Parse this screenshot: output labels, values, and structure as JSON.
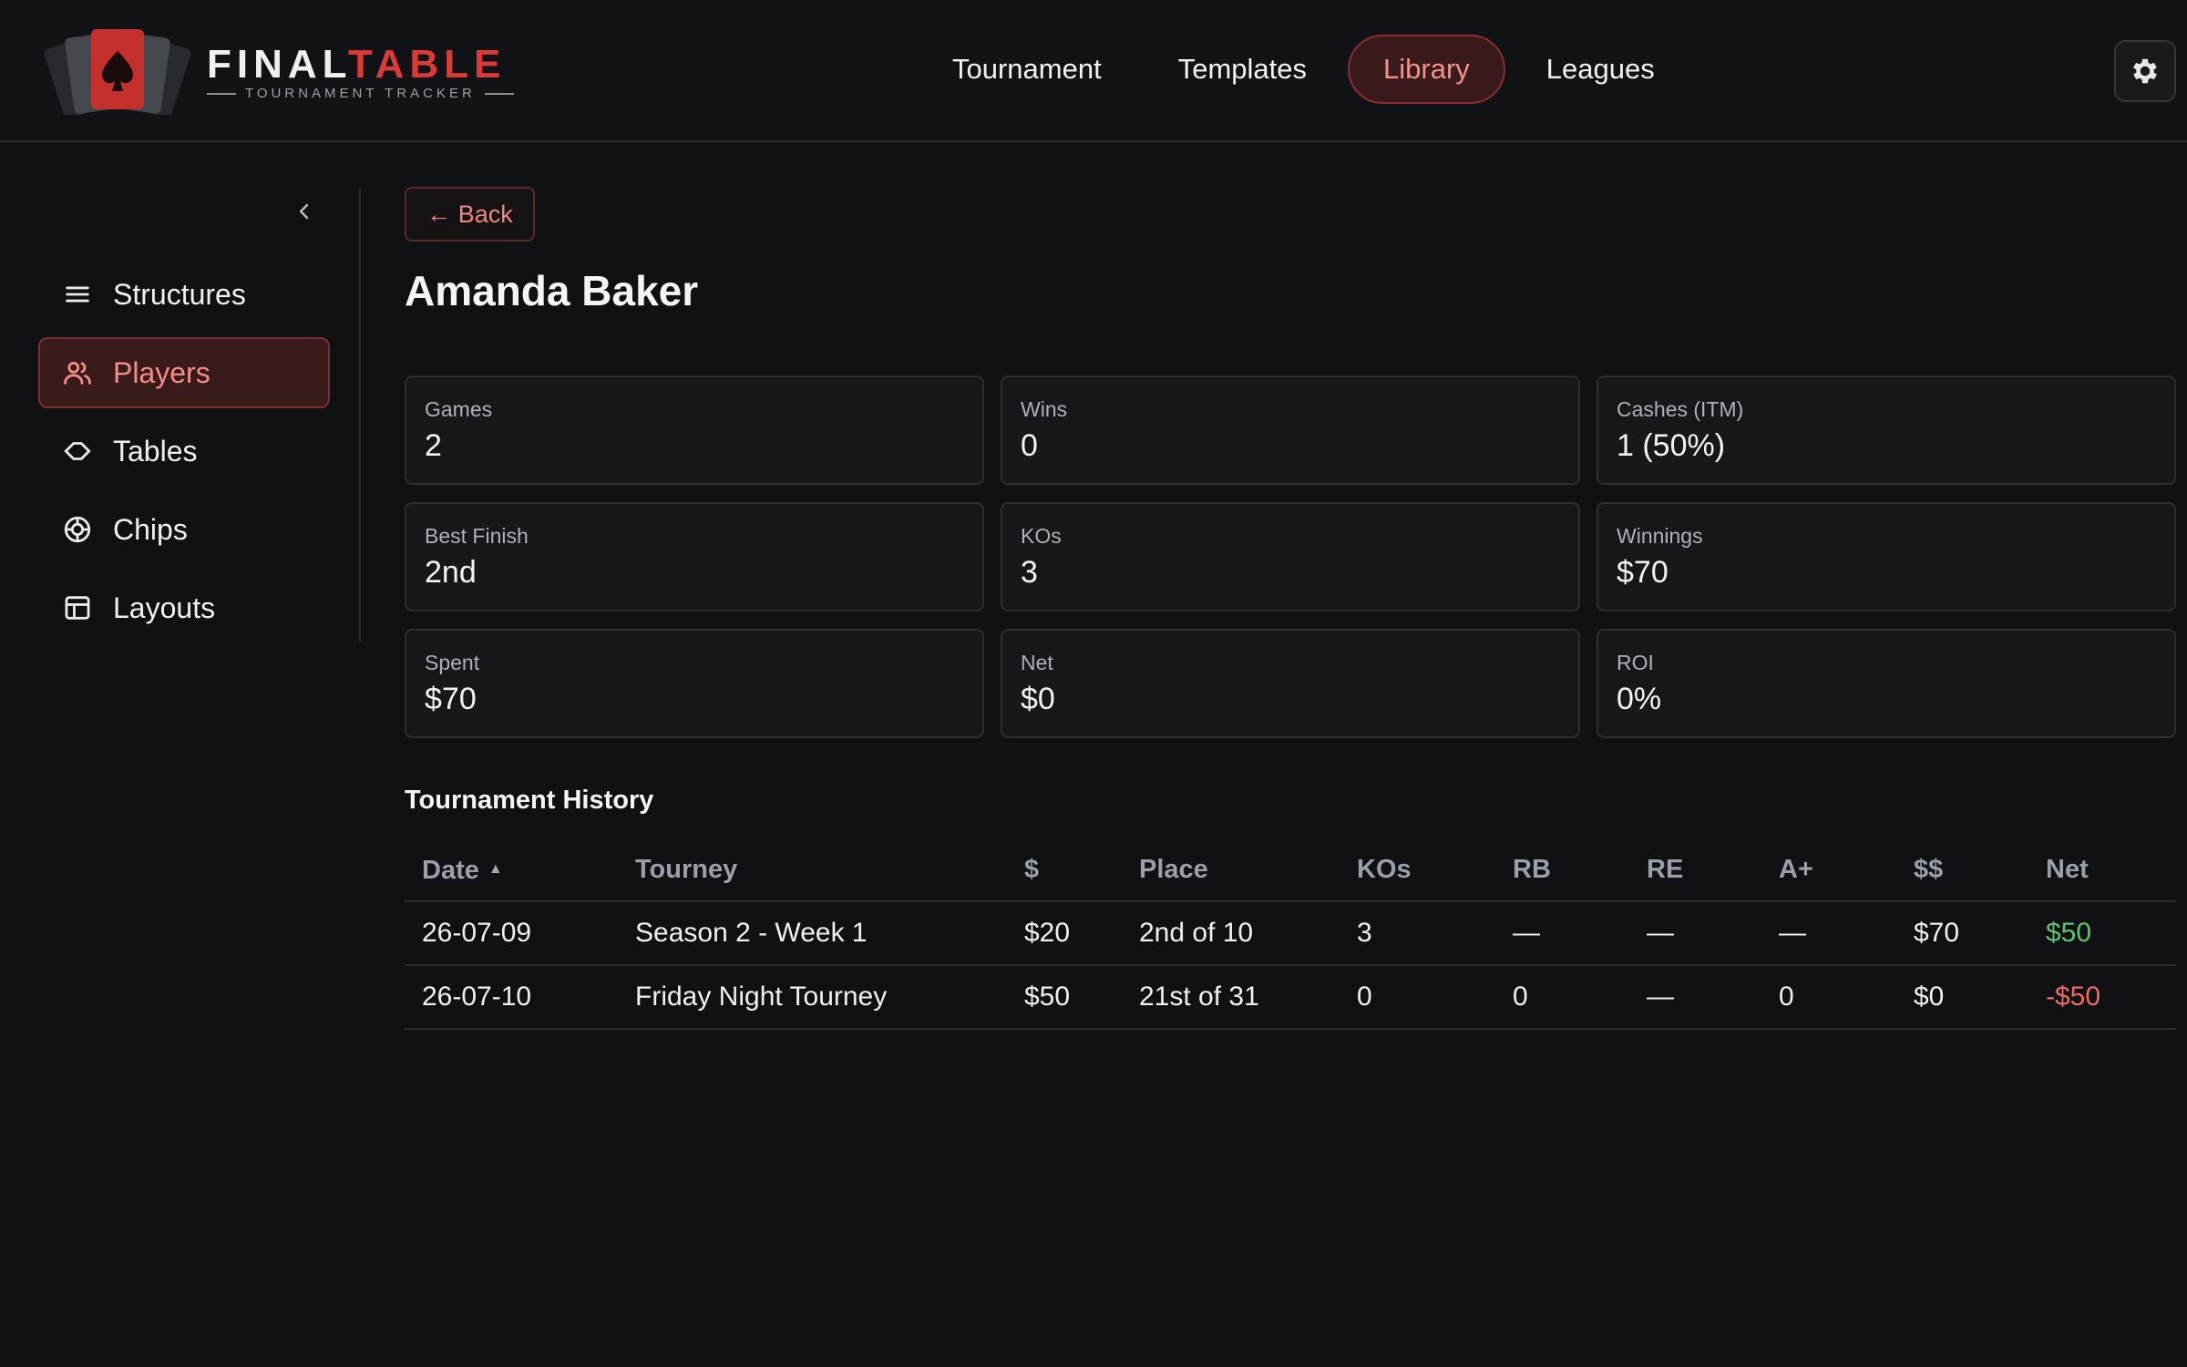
{
  "brand": {
    "title_a": "FINAL",
    "title_b": "TABLE",
    "subtitle": "TOURNAMENT TRACKER"
  },
  "nav": {
    "tabs": [
      {
        "label": "Tournament",
        "active": false
      },
      {
        "label": "Templates",
        "active": false
      },
      {
        "label": "Library",
        "active": true
      },
      {
        "label": "Leagues",
        "active": false
      }
    ]
  },
  "settings_icon": "gear-icon",
  "sidebar": {
    "collapse_icon": "chevron-left-icon",
    "items": [
      {
        "label": "Structures",
        "icon": "menu-lines-icon",
        "active": false
      },
      {
        "label": "Players",
        "icon": "users-icon",
        "active": true
      },
      {
        "label": "Tables",
        "icon": "table-oval-icon",
        "active": false
      },
      {
        "label": "Chips",
        "icon": "chip-icon",
        "active": false
      },
      {
        "label": "Layouts",
        "icon": "layout-icon",
        "active": false
      }
    ]
  },
  "back_label": "← Back",
  "player": {
    "name": "Amanda Baker"
  },
  "stats": [
    {
      "label": "Games",
      "value": "2"
    },
    {
      "label": "Wins",
      "value": "0"
    },
    {
      "label": "Cashes (ITM)",
      "value": "1 (50%)"
    },
    {
      "label": "Best Finish",
      "value": "2nd"
    },
    {
      "label": "KOs",
      "value": "3"
    },
    {
      "label": "Winnings",
      "value": "$70"
    },
    {
      "label": "Spent",
      "value": "$70"
    },
    {
      "label": "Net",
      "value": "$0"
    },
    {
      "label": "ROI",
      "value": "0%"
    }
  ],
  "history": {
    "title": "Tournament History",
    "sort_indicator": "▲",
    "columns": [
      "Date",
      "Tourney",
      "$",
      "Place",
      "KOs",
      "RB",
      "RE",
      "A+",
      "$$",
      "Net"
    ],
    "rows": [
      [
        "26-07-09",
        "Season 2 - Week 1",
        "$20",
        "2nd of 10",
        "3",
        "—",
        "—",
        "—",
        "$70",
        "$50"
      ],
      [
        "26-07-10",
        "Friday Night Tourney",
        "$50",
        "21st of 31",
        "0",
        "0",
        "—",
        "0",
        "$0",
        "-$50"
      ]
    ]
  },
  "colors": {
    "accent": "#dc3a36",
    "active_bg": "#3a1a1b",
    "positive": "#5fc46c",
    "negative": "#ef6a62"
  }
}
